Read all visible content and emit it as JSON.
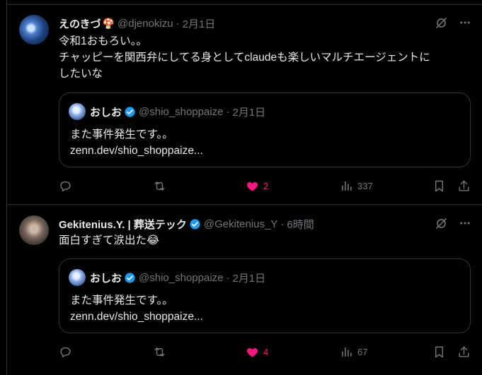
{
  "tweets": [
    {
      "name": "えのきづ",
      "name_emoji": "🍄",
      "handle": "@djenokizu",
      "sep": "·",
      "time": "2月1日",
      "text": "令和1おもろい。。\nチャッピーを関西弁にしてる身としてclaudeも楽しいマルチエージェントに\nしたいな",
      "quote": {
        "name": "おしお",
        "handle": "@shio_shoppaize",
        "sep": "·",
        "time": "2月1日",
        "text": "また事件発生です。。\nzenn.dev/shio_shoppaize..."
      },
      "stats": {
        "replies": "",
        "retweets": "",
        "likes": "2",
        "views": "337"
      },
      "liked": true
    },
    {
      "name": "Gekitenius.Y. | 葬送テック",
      "name_emoji": "",
      "handle": "@Gekitenius_Y",
      "sep": "·",
      "time": "6時間",
      "text": "面白すぎて涙出た😂",
      "quote": {
        "name": "おしお",
        "handle": "@shio_shoppaize",
        "sep": "·",
        "time": "2月1日",
        "text": "また事件発生です。。\nzenn.dev/shio_shoppaize..."
      },
      "stats": {
        "replies": "",
        "retweets": "",
        "likes": "4",
        "views": "67"
      },
      "liked": true
    }
  ],
  "colors": {
    "background": "#000000",
    "border": "#2f3336",
    "text": "#e7e9ea",
    "muted": "#71767b",
    "like": "#f91880",
    "verified": "#1d9bf0"
  },
  "icons": [
    "grok-icon",
    "more-icon",
    "reply-icon",
    "retweet-icon",
    "heart-icon",
    "views-icon",
    "bookmark-icon",
    "share-icon",
    "verified-icon"
  ]
}
